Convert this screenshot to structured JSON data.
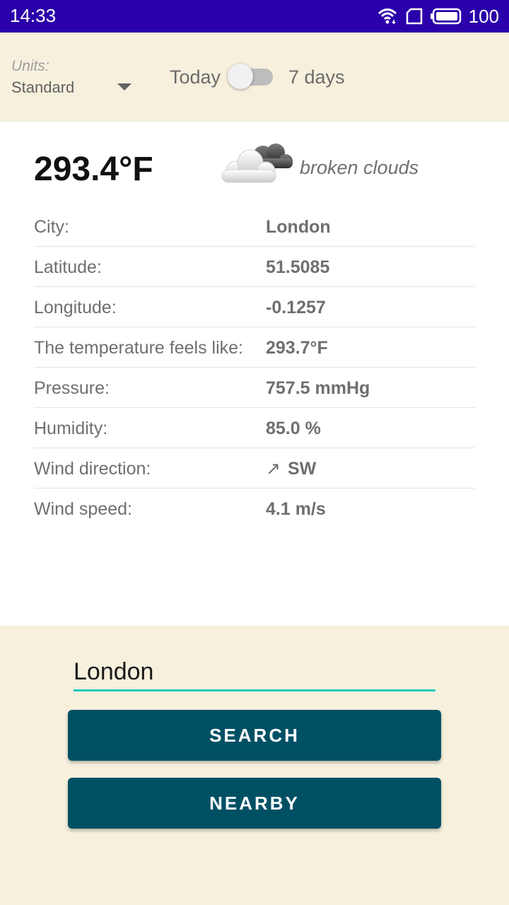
{
  "status_bar": {
    "time": "14:33",
    "battery": "100",
    "icons": [
      "wifi-icon",
      "sim-card-icon",
      "battery-icon"
    ]
  },
  "controls": {
    "units_label": "Units:",
    "units_value": "Standard",
    "today_label": "Today",
    "seven_days_label": "7 days",
    "toggle_on": false
  },
  "weather": {
    "temperature": "293.4°F",
    "description": "broken clouds",
    "icon": "broken-clouds-icon",
    "rows": [
      {
        "label": "City:",
        "value": "London"
      },
      {
        "label": "Latitude:",
        "value": "51.5085"
      },
      {
        "label": "Longitude:",
        "value": "-0.1257"
      },
      {
        "label": "The temperature feels like:",
        "value": "293.7°F"
      },
      {
        "label": "Pressure:",
        "value": "757.5 mmHg"
      },
      {
        "label": "Humidity:",
        "value": "85.0 %"
      },
      {
        "label": "Wind direction:",
        "arrow": "↗",
        "value": "SW"
      },
      {
        "label": "Wind speed:",
        "value": "4.1 m/s"
      }
    ]
  },
  "search": {
    "city_value": "London",
    "search_button": "SEARCH",
    "nearby_button": "NEARBY"
  },
  "colors": {
    "status_bar": "#2a00aa",
    "background": "#f6f0dd",
    "button": "#005064",
    "input_underline": "#1ec9c0"
  }
}
